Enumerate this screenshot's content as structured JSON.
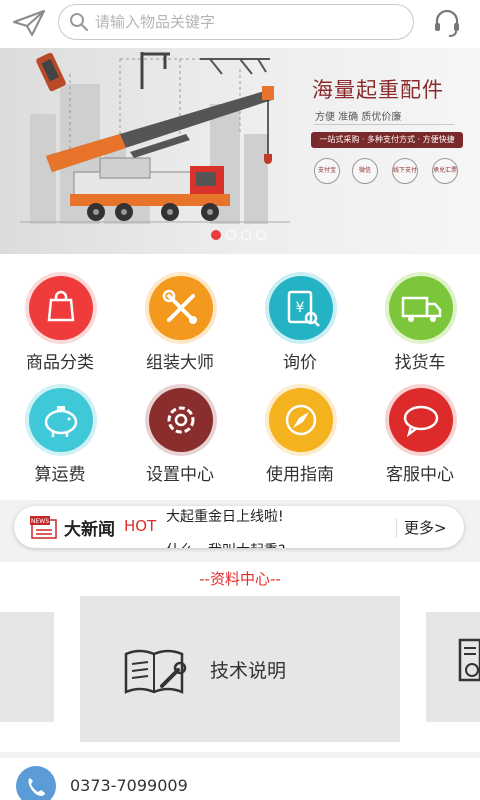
{
  "search": {
    "placeholder": "请输入物品关键字"
  },
  "banner": {
    "title": "海量起重配件",
    "subtitle": "方便 准确 质优价廉",
    "tagline": "一站式采购 · 多种支付方式 · 方便快捷",
    "payment_icons": [
      "支付宝",
      "微信",
      "线下支付",
      "承兑汇票"
    ],
    "slides": 4,
    "active_slide": 1
  },
  "menu": [
    {
      "label": "商品分类",
      "icon": "shopping-bag-icon",
      "color": "#ef3b3b"
    },
    {
      "label": "组装大师",
      "icon": "tools-icon",
      "color": "#f39a1e"
    },
    {
      "label": "询价",
      "icon": "price-inquiry-icon",
      "color": "#23b3c5"
    },
    {
      "label": "找货车",
      "icon": "truck-icon",
      "color": "#7bc63a"
    },
    {
      "label": "算运费",
      "icon": "piggy-bank-icon",
      "color": "#3fc9d8"
    },
    {
      "label": "设置中心",
      "icon": "gear-icon",
      "color": "#8a2d2d"
    },
    {
      "label": "使用指南",
      "icon": "compass-icon",
      "color": "#f3b21e"
    },
    {
      "label": "客服中心",
      "icon": "chat-bubble-icon",
      "color": "#dd2a2a"
    }
  ],
  "news": {
    "name": "大新闻",
    "hot": "HOT",
    "headline": "大起重金日上线啦!",
    "next_headline": "什么，我叫大起重?",
    "more": "更多>"
  },
  "docs": {
    "title": "--资料中心--",
    "card_label": "技术说明"
  },
  "contact": {
    "phone": "0373-7099009"
  },
  "colors": {
    "accent": "#e22b2b",
    "banner_brand": "#8a2b2b"
  }
}
